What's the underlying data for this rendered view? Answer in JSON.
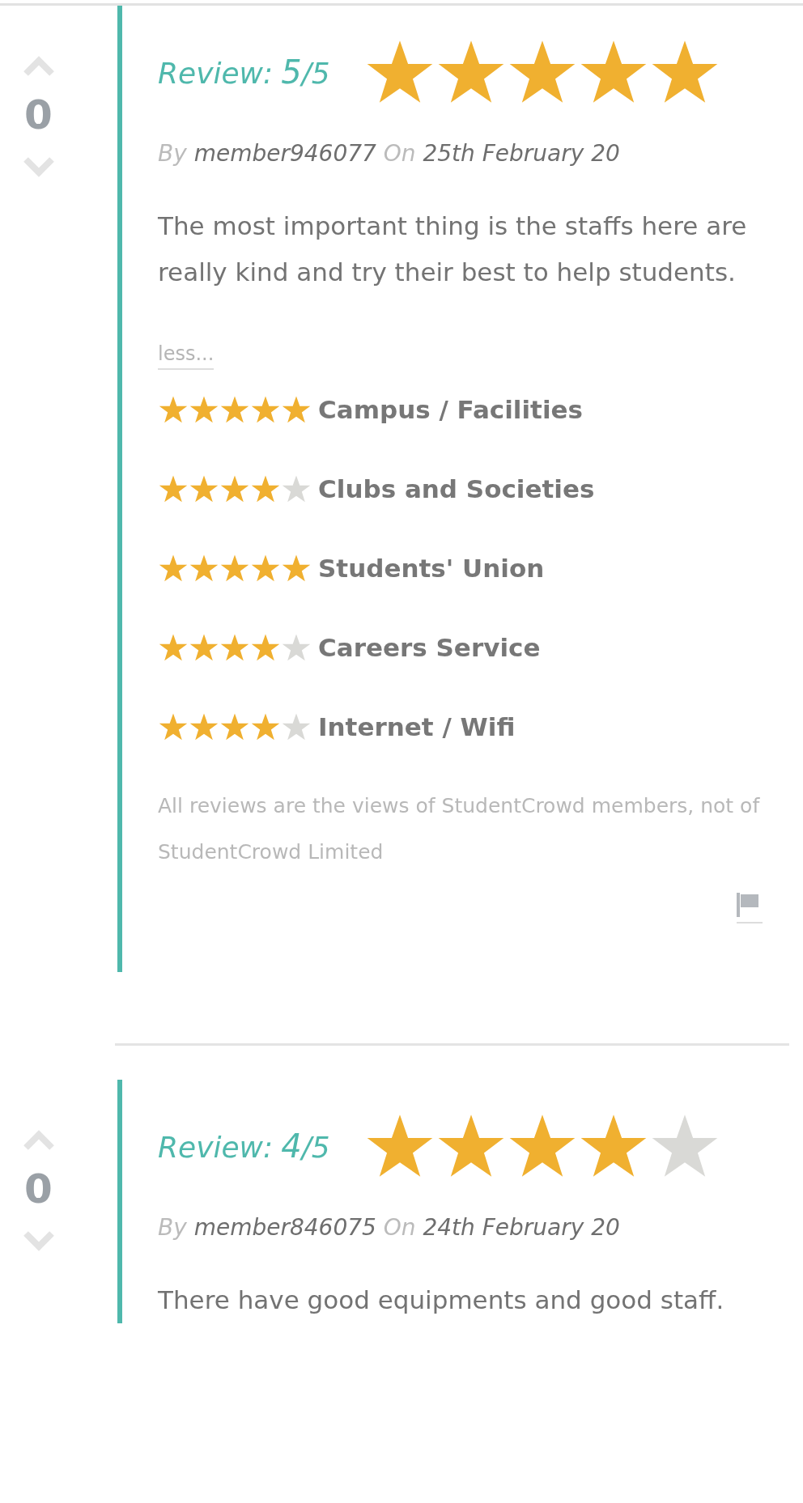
{
  "reviews": [
    {
      "votes": "0",
      "title_label": "Review:",
      "score": "5",
      "score_max": "/5",
      "stars": 5,
      "by_label": "By",
      "author": "member946077",
      "on_label": "On",
      "date": "25th February 20",
      "text": "The most important thing is the staffs here are really kind and try their best to help students.",
      "less": "less...",
      "categories": [
        {
          "name": "Campus / Facilities",
          "stars": 5
        },
        {
          "name": "Clubs and Societies",
          "stars": 4
        },
        {
          "name": "Students' Union",
          "stars": 5
        },
        {
          "name": "Careers Service",
          "stars": 4
        },
        {
          "name": "Internet / Wifi",
          "stars": 4
        }
      ],
      "disclaimer": "All reviews are the views of StudentCrowd members, not of StudentCrowd Limited",
      "flag": true
    },
    {
      "votes": "0",
      "title_label": "Review:",
      "score": "4",
      "score_max": "/5",
      "stars": 4,
      "by_label": "By",
      "author": "member846075",
      "on_label": "On",
      "date": "24th February 20",
      "text": "There have good equipments and good staff."
    }
  ]
}
